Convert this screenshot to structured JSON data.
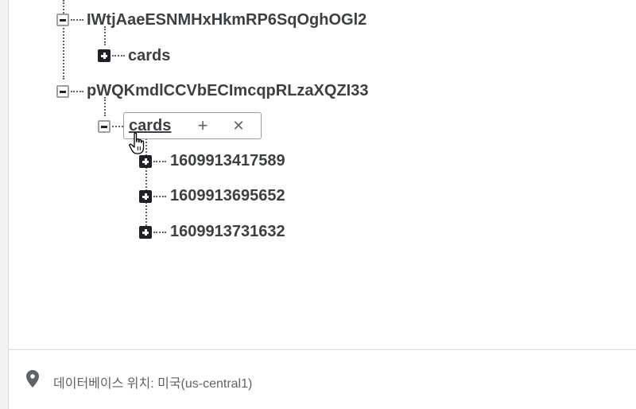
{
  "tree": {
    "nodes": [
      {
        "label": "IWtjAaeESNMHxHkmRP6SqOghOGl2",
        "state": "expanded"
      },
      {
        "label": "cards",
        "state": "collapsed"
      },
      {
        "label": "pWQKmdlCCVbECImcqpRLzaXQZI33",
        "state": "expanded"
      },
      {
        "label": "cards",
        "state": "expanded",
        "editing": true
      },
      {
        "label": "1609913417589",
        "state": "collapsed"
      },
      {
        "label": "1609913695652",
        "state": "collapsed"
      },
      {
        "label": "1609913731632",
        "state": "collapsed"
      }
    ],
    "edit_actions": {
      "add": "+",
      "remove": "✕"
    }
  },
  "footer": {
    "icon": "location-pin-icon",
    "location_text": "데이터베이스 위치: 미국(us-central1)"
  }
}
